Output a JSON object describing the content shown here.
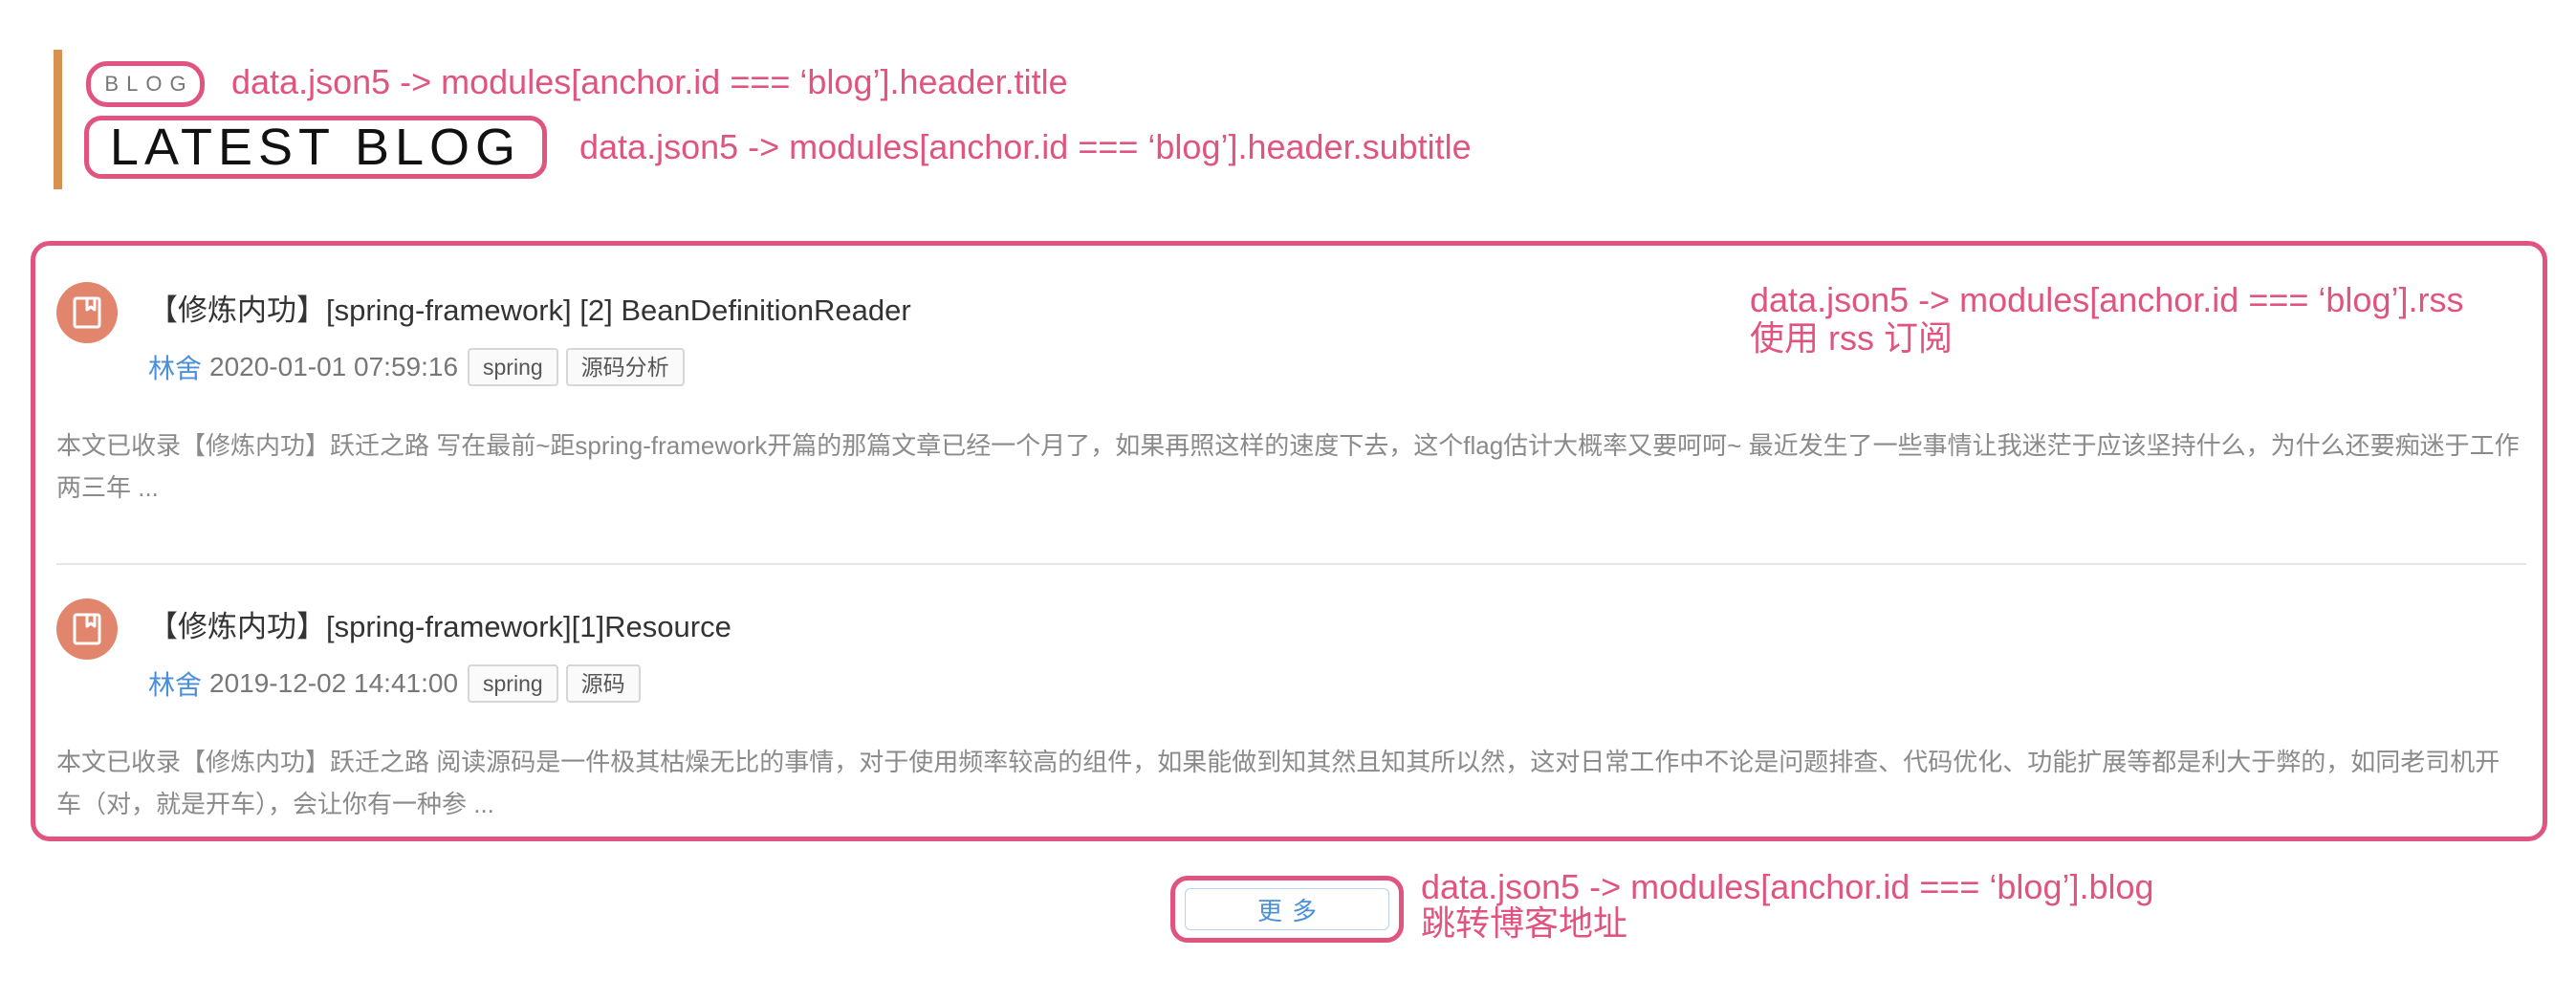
{
  "header": {
    "kicker": "BLOG",
    "title": "LATEST BLOG"
  },
  "annotations": {
    "kicker": "data.json5 -> modules[anchor.id === ‘blog’].header.title",
    "title": "data.json5 -> modules[anchor.id === ‘blog’].header.subtitle",
    "rss_line1": "data.json5 -> modules[anchor.id === ‘blog’].rss",
    "rss_line2": "使用 rss 订阅",
    "more_line1": "data.json5 -> modules[anchor.id === ‘blog’].blog",
    "more_line2": "跳转博客地址"
  },
  "posts": [
    {
      "icon": "bookmark-icon",
      "title": "【修炼内功】[spring-framework] [2] BeanDefinitionReader",
      "author": "林舍",
      "date": "2020-01-01 07:59:16",
      "tags": [
        "spring",
        "源码分析"
      ],
      "excerpt": "本文已收录【修炼内功】跃迁之路 写在最前~距spring-framework开篇的那篇文章已经一个月了，如果再照这样的速度下去，这个flag估计大概率又要呵呵~ 最近发生了一些事情让我迷茫于应该坚持什么，为什么还要痴迷于工作两三年 ..."
    },
    {
      "icon": "bookmark-icon",
      "title": "【修炼内功】[spring-framework][1]Resource",
      "author": "林舍",
      "date": "2019-12-02 14:41:00",
      "tags": [
        "spring",
        "源码"
      ],
      "excerpt": "本文已收录【修炼内功】跃迁之路 阅读源码是一件极其枯燥无比的事情，对于使用频率较高的组件，如果能做到知其然且知其所以然，这对日常工作中不论是问题排查、代码优化、功能扩展等都是利大于弊的，如同老司机开车（对，就是开车），会让你有一种参 ..."
    }
  ],
  "more_button": {
    "label": "更多"
  },
  "colors": {
    "annotation": "#e0547f",
    "accent": "#d9914f",
    "avatar": "#e2856d",
    "link": "#4a90d9"
  }
}
